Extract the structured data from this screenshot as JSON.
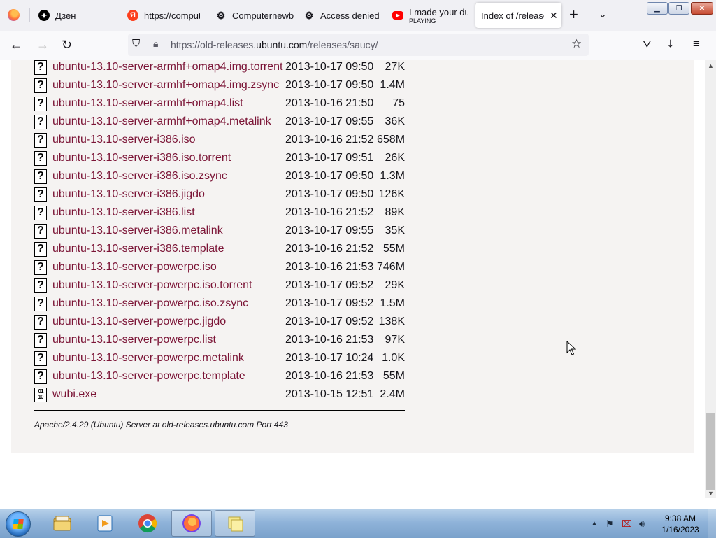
{
  "browser": {
    "tabs": [
      {
        "title": "Дзен",
        "icon": "dzen-icon",
        "active": false
      },
      {
        "title": "https://comput",
        "icon": "yandex-icon",
        "active": false
      },
      {
        "title": "Computernewb",
        "icon": "computernewb-icon",
        "active": false
      },
      {
        "title": "Access denied",
        "icon": "computernewb-icon",
        "active": false
      },
      {
        "title": "I made your du",
        "subtitle": "PLAYING",
        "icon": "youtube-icon",
        "active": false
      },
      {
        "title": "Index of /release",
        "icon": "none",
        "active": true
      }
    ],
    "url_prefix": "https://old-releases.",
    "url_domain": "ubuntu.com",
    "url_path": "/releases/saucy/"
  },
  "listing": {
    "rows": [
      {
        "name": "ubuntu-13.10-server-armhf+omap4.img.torrent",
        "date": "2013-10-17 09:50",
        "size": "27K",
        "icon": "unknown-file-icon"
      },
      {
        "name": "ubuntu-13.10-server-armhf+omap4.img.zsync",
        "date": "2013-10-17 09:50",
        "size": "1.4M",
        "icon": "unknown-file-icon"
      },
      {
        "name": "ubuntu-13.10-server-armhf+omap4.list",
        "date": "2013-10-16 21:50",
        "size": "75",
        "icon": "unknown-file-icon"
      },
      {
        "name": "ubuntu-13.10-server-armhf+omap4.metalink",
        "date": "2013-10-17 09:55",
        "size": "36K",
        "icon": "unknown-file-icon"
      },
      {
        "name": "ubuntu-13.10-server-i386.iso",
        "date": "2013-10-16 21:52",
        "size": "658M",
        "icon": "unknown-file-icon"
      },
      {
        "name": "ubuntu-13.10-server-i386.iso.torrent",
        "date": "2013-10-17 09:51",
        "size": "26K",
        "icon": "unknown-file-icon"
      },
      {
        "name": "ubuntu-13.10-server-i386.iso.zsync",
        "date": "2013-10-17 09:50",
        "size": "1.3M",
        "icon": "unknown-file-icon"
      },
      {
        "name": "ubuntu-13.10-server-i386.jigdo",
        "date": "2013-10-17 09:50",
        "size": "126K",
        "icon": "unknown-file-icon"
      },
      {
        "name": "ubuntu-13.10-server-i386.list",
        "date": "2013-10-16 21:52",
        "size": "89K",
        "icon": "unknown-file-icon"
      },
      {
        "name": "ubuntu-13.10-server-i386.metalink",
        "date": "2013-10-17 09:55",
        "size": "35K",
        "icon": "unknown-file-icon"
      },
      {
        "name": "ubuntu-13.10-server-i386.template",
        "date": "2013-10-16 21:52",
        "size": "55M",
        "icon": "unknown-file-icon"
      },
      {
        "name": "ubuntu-13.10-server-powerpc.iso",
        "date": "2013-10-16 21:53",
        "size": "746M",
        "icon": "unknown-file-icon"
      },
      {
        "name": "ubuntu-13.10-server-powerpc.iso.torrent",
        "date": "2013-10-17 09:52",
        "size": "29K",
        "icon": "unknown-file-icon"
      },
      {
        "name": "ubuntu-13.10-server-powerpc.iso.zsync",
        "date": "2013-10-17 09:52",
        "size": "1.5M",
        "icon": "unknown-file-icon"
      },
      {
        "name": "ubuntu-13.10-server-powerpc.jigdo",
        "date": "2013-10-17 09:52",
        "size": "138K",
        "icon": "unknown-file-icon"
      },
      {
        "name": "ubuntu-13.10-server-powerpc.list",
        "date": "2013-10-16 21:53",
        "size": "97K",
        "icon": "unknown-file-icon"
      },
      {
        "name": "ubuntu-13.10-server-powerpc.metalink",
        "date": "2013-10-17 10:24",
        "size": "1.0K",
        "icon": "unknown-file-icon"
      },
      {
        "name": "ubuntu-13.10-server-powerpc.template",
        "date": "2013-10-16 21:53",
        "size": "55M",
        "icon": "unknown-file-icon"
      },
      {
        "name": "wubi.exe",
        "date": "2013-10-15 12:51",
        "size": "2.4M",
        "icon": "binary-file-icon"
      }
    ],
    "footer": "Apache/2.4.29 (Ubuntu) Server at old-releases.ubuntu.com Port 443"
  },
  "taskbar": {
    "apps": [
      "file-explorer-icon",
      "media-player-icon",
      "chrome-icon",
      "firefox-icon",
      "notes-icon"
    ],
    "clock_time": "9:38 AM",
    "clock_date": "1/16/2023"
  },
  "colors": {
    "link": "#7b1436",
    "panel_bg": "#f5f3f2",
    "tabbar_bg": "#f0f0f4"
  }
}
